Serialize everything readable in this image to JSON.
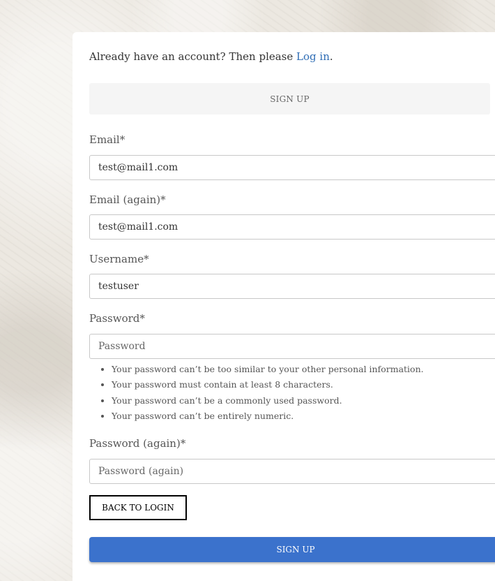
{
  "account_prompt": {
    "text": "Already have an account? Then please ",
    "link": "Log in",
    "suffix": "."
  },
  "header": {
    "title": "SIGN UP"
  },
  "form": {
    "email": {
      "label": "Email*",
      "value": "test@mail1.com"
    },
    "email_again": {
      "label": "Email (again)*",
      "value": "test@mail1.com"
    },
    "username": {
      "label": "Username*",
      "value": "testuser"
    },
    "password": {
      "label": "Password*",
      "value": "",
      "placeholder": "Password"
    },
    "password_help": [
      "Your password can’t be too similar to your other personal information.",
      "Your password must contain at least 8 characters.",
      "Your password can’t be a commonly used password.",
      "Your password can’t be entirely numeric."
    ],
    "password_again": {
      "label": "Password (again)*",
      "value": "",
      "placeholder": "Password (again)"
    }
  },
  "buttons": {
    "back_to_login": "BACK TO LOGIN",
    "sign_up": "SIGN UP"
  },
  "colors": {
    "link": "#2f6db5",
    "primary_button": "#3b72cc",
    "header_bg": "#f5f5f5"
  }
}
